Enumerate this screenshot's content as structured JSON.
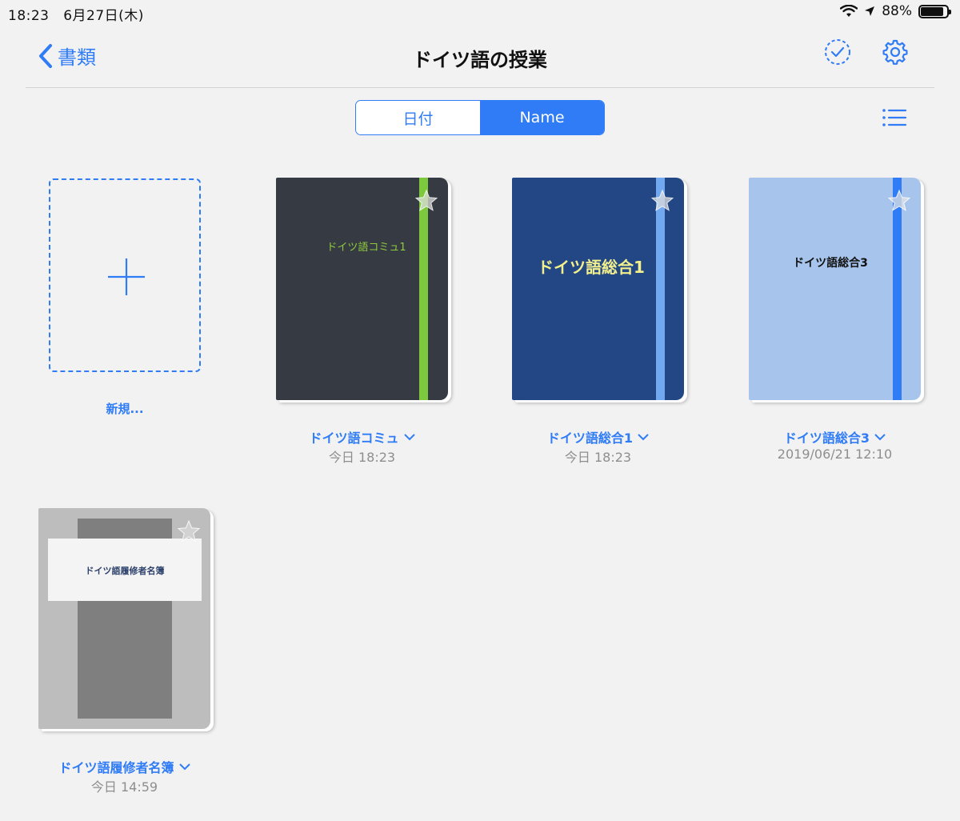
{
  "status": {
    "time": "18:23",
    "date": "6月27日(木)",
    "battery": "88%",
    "battery_level": 0.88
  },
  "nav": {
    "back_label": "書類",
    "title": "ドイツ語の授業"
  },
  "segment": {
    "date_label": "日付",
    "name_label": "Name",
    "selected": "Name"
  },
  "new_item": {
    "label": "新規..."
  },
  "documents": [
    {
      "cover_title": "ドイツ語コミュ1",
      "name": "ドイツ語コミュ",
      "date": "今日 18:23",
      "cover_color": "#363a42",
      "strap_color": "#7dc93d",
      "title_color": "#8ecb3e"
    },
    {
      "cover_title": "ドイツ語総合1",
      "name": "ドイツ語総合1",
      "date": "今日 18:23",
      "cover_color": "#234684",
      "strap_color": "#72a8ef",
      "title_color": "#f2ef8d"
    },
    {
      "cover_title": "ドイツ語総合3",
      "name": "ドイツ語総合3",
      "date": "2019/06/21 12:10",
      "cover_color": "#a7c5ec",
      "strap_color": "#2f7cf6",
      "title_color": "#111111"
    },
    {
      "cover_title": "ドイツ語履修者名簿",
      "name": "ドイツ語履修者名簿",
      "date": "今日 14:59",
      "cover_color": "#bdbdbd",
      "strap_color": "#7f7f7f",
      "title_color": "#2a3f6a"
    }
  ],
  "colors": {
    "accent": "#2f7cf6",
    "background": "#f2f2f2"
  }
}
